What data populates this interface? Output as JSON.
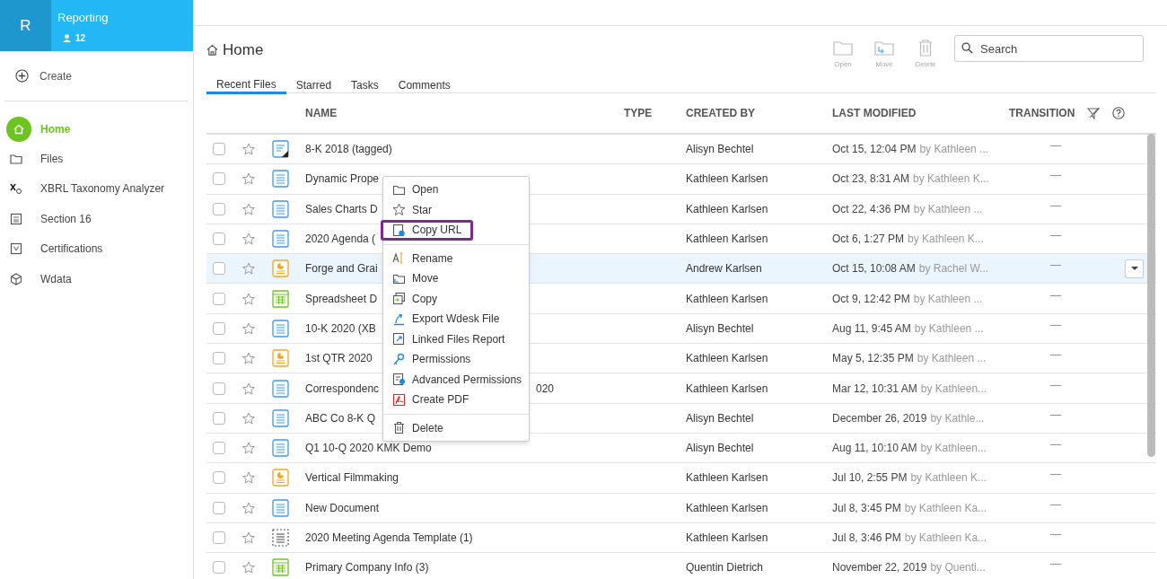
{
  "workspace": {
    "initial": "R",
    "name": "Reporting",
    "members": "12"
  },
  "sidebar": {
    "create": "Create",
    "items": [
      {
        "label": "Home",
        "selected": true
      },
      {
        "label": "Files",
        "selected": false
      },
      {
        "label": "XBRL Taxonomy Analyzer",
        "selected": false
      },
      {
        "label": "Section 16",
        "selected": false
      },
      {
        "label": "Certifications",
        "selected": false
      },
      {
        "label": "Wdata",
        "selected": false
      }
    ]
  },
  "page_title": "Home",
  "toolbar": [
    {
      "label": "Open"
    },
    {
      "label": "Move"
    },
    {
      "label": "Delete"
    }
  ],
  "search": {
    "placeholder": "Search"
  },
  "tabs": [
    {
      "label": "Recent Files",
      "selected": true
    },
    {
      "label": "Starred",
      "selected": false
    },
    {
      "label": "Tasks",
      "selected": false
    },
    {
      "label": "Comments",
      "selected": false
    }
  ],
  "table": {
    "columns": [
      "NAME",
      "TYPE",
      "CREATED BY",
      "LAST MODIFIED",
      "TRANSITION"
    ],
    "rows": [
      {
        "kind": "note",
        "name": "8-K 2018 (tagged)",
        "created_by": "Alisyn Bechtel",
        "modified": "Oct 15, 12:04 PM",
        "modified_by": "by Kathleen ...",
        "transition": "—",
        "selected": false
      },
      {
        "kind": "document",
        "name": "Dynamic Prope",
        "created_by": "Kathleen Karlsen",
        "modified": "Oct 23, 8:31 AM",
        "modified_by": "by Kathleen K...",
        "transition": "—",
        "selected": false
      },
      {
        "kind": "document",
        "name": "Sales Charts D",
        "created_by": "Kathleen Karlsen",
        "modified": "Oct 22, 4:36 PM",
        "modified_by": "by Kathleen ...",
        "transition": "—",
        "selected": false
      },
      {
        "kind": "document",
        "name": "2020 Agenda (",
        "created_by": "Kathleen Karlsen",
        "modified": "Oct 6, 1:27 PM",
        "modified_by": "by Kathleen K...",
        "transition": "—",
        "selected": false
      },
      {
        "kind": "presentation",
        "name": "Forge and Grai",
        "created_by": "Andrew Karlsen",
        "modified": "Oct 15, 10:08 AM",
        "modified_by": "by Rachel W...",
        "transition": "—",
        "selected": true
      },
      {
        "kind": "spreadsheet",
        "name": "Spreadsheet D",
        "created_by": "Kathleen Karlsen",
        "modified": "Oct 9, 12:42 PM",
        "modified_by": "by Kathleen ...",
        "transition": "—",
        "selected": false
      },
      {
        "kind": "document",
        "name": "10-K 2020 (XB",
        "created_by": "Alisyn Bechtel",
        "modified": "Aug 11, 9:45 AM",
        "modified_by": "by Kathleen ...",
        "transition": "—",
        "selected": false
      },
      {
        "kind": "presentation",
        "name": "1st QTR 2020",
        "created_by": "Kathleen Karlsen",
        "modified": "May 5, 12:35 PM",
        "modified_by": "by Kathleen ...",
        "transition": "—",
        "selected": false
      },
      {
        "kind": "document",
        "name": "Correspondenc",
        "name_tail": "020",
        "created_by": "Kathleen Karlsen",
        "modified": "Mar 12, 10:31 AM",
        "modified_by": "by Kathleen...",
        "transition": "—",
        "selected": false
      },
      {
        "kind": "document",
        "name": "ABC Co 8-K Q",
        "created_by": "Alisyn Bechtel",
        "modified": "December 26, 2019",
        "modified_by": "by Kathle...",
        "transition": "—",
        "selected": false
      },
      {
        "kind": "document",
        "name": "Q1 10-Q 2020 KMK Demo",
        "created_by": "Alisyn Bechtel",
        "modified": "Aug 11, 10:10 AM",
        "modified_by": "by Kathleen...",
        "transition": "—",
        "selected": false
      },
      {
        "kind": "presentation",
        "name": "Vertical Filmmaking",
        "created_by": "Kathleen Karlsen",
        "modified": "Jul 10, 2:55 PM",
        "modified_by": "by Kathleen K...",
        "transition": "—",
        "selected": false
      },
      {
        "kind": "document",
        "name": "New Document",
        "created_by": "Kathleen Karlsen",
        "modified": "Jul 8, 3:45 PM",
        "modified_by": "by Kathleen Ka...",
        "transition": "—",
        "selected": false
      },
      {
        "kind": "template",
        "name": "2020 Meeting Agenda Template (1)",
        "created_by": "Kathleen Karlsen",
        "modified": "Jul 8, 3:46 PM",
        "modified_by": "by Kathleen Ka...",
        "transition": "—",
        "selected": false
      },
      {
        "kind": "spreadsheet",
        "name": "Primary Company Info (3)",
        "created_by": "Quentin Dietrich",
        "modified": "November 22, 2019",
        "modified_by": "by Quenti...",
        "transition": "—",
        "selected": false
      }
    ]
  },
  "context_menu": {
    "groups": [
      [
        {
          "label": "Open",
          "highlighted": false
        },
        {
          "label": "Star",
          "highlighted": false
        },
        {
          "label": "Copy URL",
          "highlighted": true
        }
      ],
      [
        {
          "label": "Rename",
          "highlighted": false
        },
        {
          "label": "Move",
          "highlighted": false
        },
        {
          "label": "Copy",
          "highlighted": false
        },
        {
          "label": "Export Wdesk File",
          "highlighted": false
        },
        {
          "label": "Linked Files Report",
          "highlighted": false
        },
        {
          "label": "Permissions",
          "highlighted": false
        },
        {
          "label": "Advanced Permissions",
          "highlighted": false
        },
        {
          "label": "Create PDF",
          "highlighted": false
        }
      ],
      [
        {
          "label": "Delete",
          "highlighted": false
        }
      ]
    ]
  }
}
